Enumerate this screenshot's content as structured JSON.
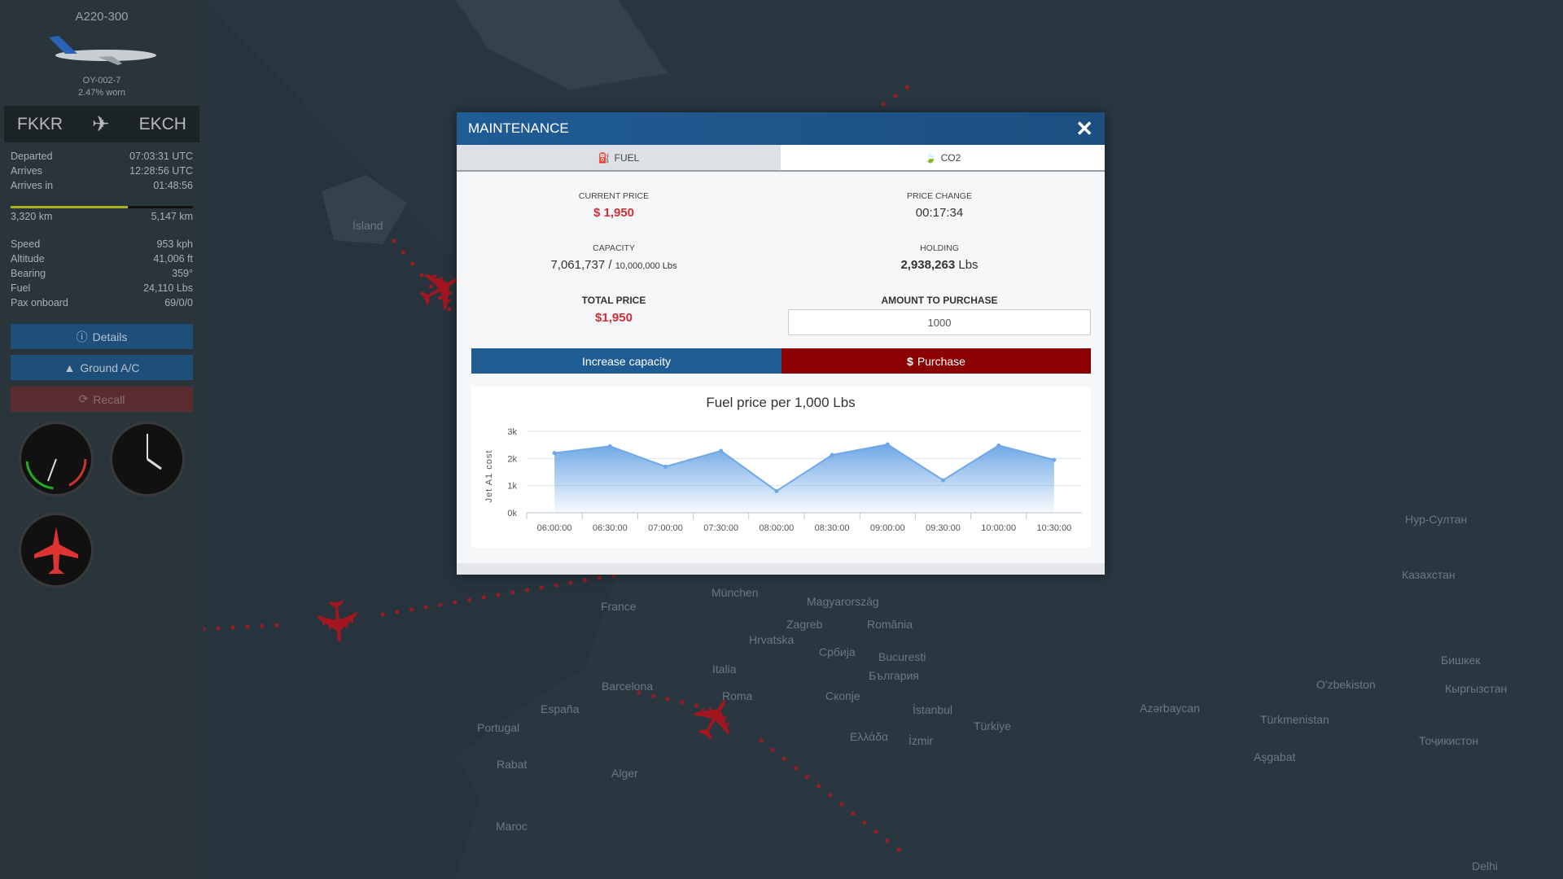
{
  "sidebar": {
    "aircraft_type": "A220-300",
    "registration": "OY-002-7",
    "wear": "2.47% worn",
    "origin": "FKKR",
    "destination": "EKCH",
    "times": [
      {
        "label": "Departed",
        "value": "07:03:31 UTC"
      },
      {
        "label": "Arrives",
        "value": "12:28:56 UTC"
      },
      {
        "label": "Arrives in",
        "value": "01:48:56"
      }
    ],
    "progress": {
      "flown": "3,320 km",
      "total": "5,147 km",
      "fraction": 0.645
    },
    "stats": [
      {
        "label": "Speed",
        "value": "953 kph"
      },
      {
        "label": "Altitude",
        "value": "41,006 ft"
      },
      {
        "label": "Bearing",
        "value": "359°"
      },
      {
        "label": "Fuel",
        "value": "24,110 Lbs"
      },
      {
        "label": "Pax onboard",
        "value": "69/0/0"
      }
    ],
    "buttons": {
      "details": "Details",
      "ground": "Ground A/C",
      "recall": "Recall"
    }
  },
  "modal": {
    "title": "MAINTENANCE",
    "tabs": [
      {
        "label": "FUEL",
        "icon": "fuel-pump-icon",
        "active": true
      },
      {
        "label": "CO2",
        "icon": "leaf-icon",
        "active": false
      }
    ],
    "current_price_label": "CURRENT PRICE",
    "current_price": "$ 1,950",
    "price_change_label": "PRICE CHANGE",
    "price_change": "00:17:34",
    "capacity_label": "CAPACITY",
    "capacity_used": "7,061,737",
    "capacity_sep": "/",
    "capacity_total": "10,000,000 Lbs",
    "holding_label": "HOLDING",
    "holding_value": "2,938,263",
    "holding_unit": "Lbs",
    "total_price_label": "TOTAL PRICE",
    "total_price": "$1,950",
    "amount_label": "AMOUNT TO PURCHASE",
    "amount_value": "1000",
    "increase_capacity": "Increase capacity",
    "purchase": "Purchase",
    "colors": {
      "header": "#1f5c94",
      "increase": "#1f5c94",
      "purchase": "#8b0000",
      "price": "#d42d3a"
    }
  },
  "chart_data": {
    "type": "area",
    "title": "Fuel price per 1,000 Lbs",
    "ylabel": "Jet A1 cost",
    "xlabel": "",
    "categories": [
      "06:00:00",
      "06:30:00",
      "07:00:00",
      "07:30:00",
      "08:00:00",
      "08:30:00",
      "09:00:00",
      "09:30:00",
      "10:00:00",
      "10:30:00"
    ],
    "values": [
      2200,
      2450,
      1700,
      2280,
      800,
      2130,
      2520,
      1200,
      2480,
      1950
    ],
    "yticks": [
      "0k",
      "1k",
      "2k",
      "3k"
    ],
    "ylim": [
      0,
      3000
    ],
    "grid": true,
    "color": "#6fa8e6"
  },
  "map": {
    "labels": [
      "Ísland",
      "France",
      "München",
      "Magyarország",
      "Zagreb",
      "România",
      "Hrvatska",
      "Србија",
      "Bucuresti",
      "България",
      "Italia",
      "Barcelona",
      "Roma",
      "Скопје",
      "España",
      "Portugal",
      "İstanbul",
      "Türkiye",
      "Ελλάδα",
      "İzmir",
      "Rabat",
      "Alger",
      "Azərbaycan",
      "O'zbekiston",
      "Türkmenistan",
      "Aşgabat",
      "Нур-Султан",
      "Казахстан",
      "Бишкек",
      "Кыргызстан",
      "Тоҷикистон",
      "Delhi",
      "Maroc"
    ]
  }
}
